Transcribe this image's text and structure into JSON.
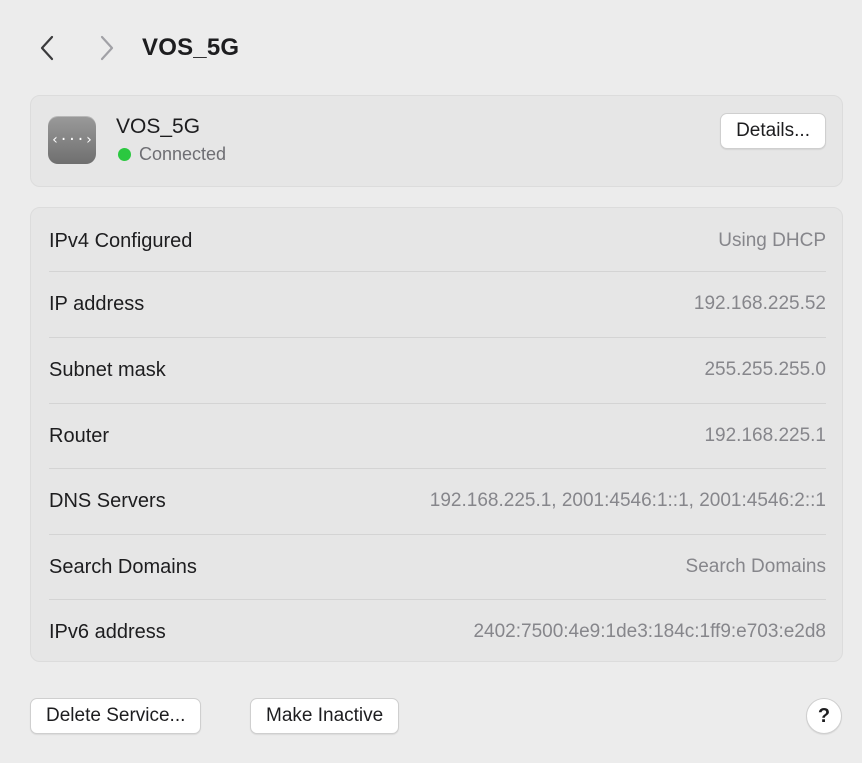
{
  "header": {
    "title": "VOS_5G",
    "back_icon": "chevron-left-icon",
    "forward_icon": "chevron-right-icon"
  },
  "service": {
    "name": "VOS_5G",
    "icon": "wifi-hotspot-icon",
    "icon_glyph": "‹···›",
    "status": "Connected",
    "status_color": "#2bc840",
    "details_label": "Details..."
  },
  "info_rows": [
    {
      "label": "IPv4 Configured",
      "value": "Using DHCP"
    },
    {
      "label": "IP address",
      "value": "192.168.225.52"
    },
    {
      "label": "Subnet mask",
      "value": "255.255.255.0"
    },
    {
      "label": "Router",
      "value": "192.168.225.1"
    },
    {
      "label": "DNS Servers",
      "value": "192.168.225.1, 2001:4546:1::1, 2001:4546:2::1"
    },
    {
      "label": "Search Domains",
      "value": "Search Domains"
    },
    {
      "label": "IPv6 address",
      "value": "2402:7500:4e9:1de3:184c:1ff9:e703:e2d8"
    }
  ],
  "footer": {
    "delete_label": "Delete Service...",
    "inactive_label": "Make Inactive",
    "help_label": "?"
  }
}
